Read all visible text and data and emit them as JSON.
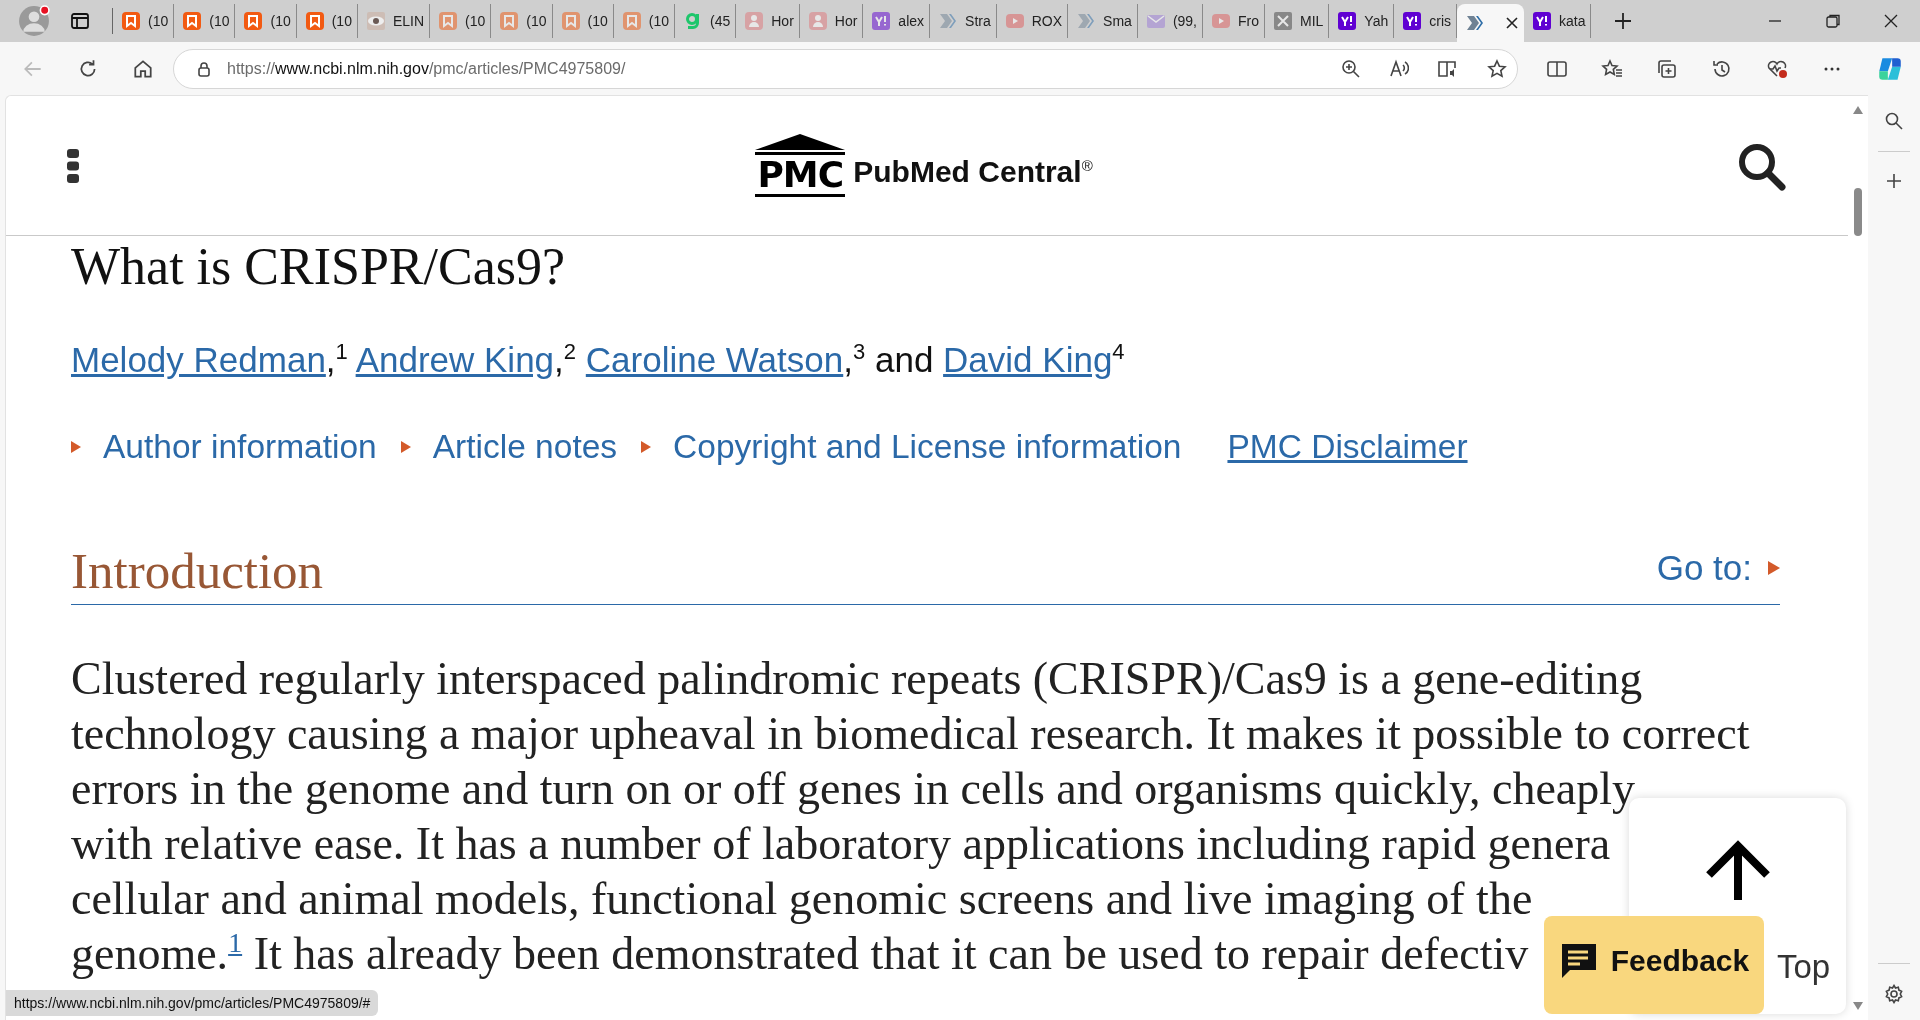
{
  "browser": {
    "tabs": [
      {
        "kind": "bookmark",
        "label": "(10",
        "dimmed": false,
        "selected": false
      },
      {
        "kind": "bookmark",
        "label": "(10",
        "dimmed": false,
        "selected": false
      },
      {
        "kind": "bookmark",
        "label": "(10",
        "dimmed": false,
        "selected": false
      },
      {
        "kind": "bookmark",
        "label": "(10",
        "dimmed": false,
        "selected": false
      },
      {
        "kind": "eye",
        "label": "ELIN",
        "dimmed": false,
        "selected": false
      },
      {
        "kind": "bookmark",
        "label": "(10",
        "dimmed": true,
        "selected": false
      },
      {
        "kind": "bookmark",
        "label": "(10",
        "dimmed": true,
        "selected": false
      },
      {
        "kind": "bookmark",
        "label": "(10",
        "dimmed": true,
        "selected": false
      },
      {
        "kind": "bookmark",
        "label": "(10",
        "dimmed": true,
        "selected": false
      },
      {
        "kind": "g",
        "label": "(45",
        "dimmed": false,
        "selected": false
      },
      {
        "kind": "figure",
        "label": "Hor",
        "dimmed": true,
        "selected": false
      },
      {
        "kind": "figure",
        "label": "Hor",
        "dimmed": true,
        "selected": false
      },
      {
        "kind": "yahoo",
        "label": "alex",
        "dimmed": true,
        "selected": false
      },
      {
        "kind": "chevron",
        "label": "Stra",
        "dimmed": true,
        "selected": false
      },
      {
        "kind": "video",
        "label": "ROX",
        "dimmed": true,
        "selected": false
      },
      {
        "kind": "chevron",
        "label": "Sma",
        "dimmed": true,
        "selected": false
      },
      {
        "kind": "mail",
        "label": "(99,",
        "dimmed": true,
        "selected": false
      },
      {
        "kind": "video",
        "label": "Fro",
        "dimmed": true,
        "selected": false
      },
      {
        "kind": "x",
        "label": "MIL",
        "dimmed": true,
        "selected": false
      },
      {
        "kind": "yahoo",
        "label": "Yah",
        "dimmed": false,
        "selected": false
      },
      {
        "kind": "yahoo",
        "label": "cris",
        "dimmed": false,
        "selected": false
      },
      {
        "kind": "chevron",
        "dimmed": false,
        "selected": true
      },
      {
        "kind": "yahoo",
        "label": "kata",
        "dimmed": false,
        "selected": false
      }
    ],
    "address": {
      "scheme": "https://",
      "host": "www.ncbi.nlm.nih.gov",
      "path": "/pmc/articles/PMC4975809/"
    }
  },
  "site": {
    "logo_mark": "PMC",
    "logo_text": "PubMed Central$^{®}$"
  },
  "article": {
    "title": "What is CRISPR/Cas9?",
    "authors": [
      {
        "name": "Melody Redman",
        "sep": ",",
        "note": "1"
      },
      {
        "name": "Andrew King",
        "sep": ",",
        "note": "2"
      },
      {
        "name": "Caroline Watson",
        "sep": ",",
        "note": "3",
        "after": "and"
      },
      {
        "name": "David King",
        "note": "4"
      }
    ],
    "info_links": [
      {
        "kind": "toggle",
        "label": "Author information"
      },
      {
        "kind": "toggle",
        "label": "Article notes"
      },
      {
        "kind": "toggle",
        "label": "Copyright and License information"
      },
      {
        "kind": "link",
        "label": "PMC Disclaimer"
      }
    ],
    "section": {
      "heading": "Introduction",
      "goto": "Go to:",
      "lines": [
        "Clustered regularly interspaced palindromic repeats (CRISPR)/Cas9 is a gene-editing",
        "technology causing a major upheaval in biomedical research. It makes it possible to correct",
        "errors in the genome and turn on or off genes in cells and organisms quickly, cheaply",
        "with relative ease. It has a number of laboratory applications including rapid genera",
        "cellular and animal models, functional genomic screens and live imaging of the",
        "genome.$^{1}$ It has already been demonstrated that it can be used to repair defectiv"
      ]
    }
  },
  "overlays": {
    "top": "Top",
    "feedback": "Feedback",
    "status_url": "https://www.ncbi.nlm.nih.gov/pmc/articles/PMC4975809/#"
  }
}
